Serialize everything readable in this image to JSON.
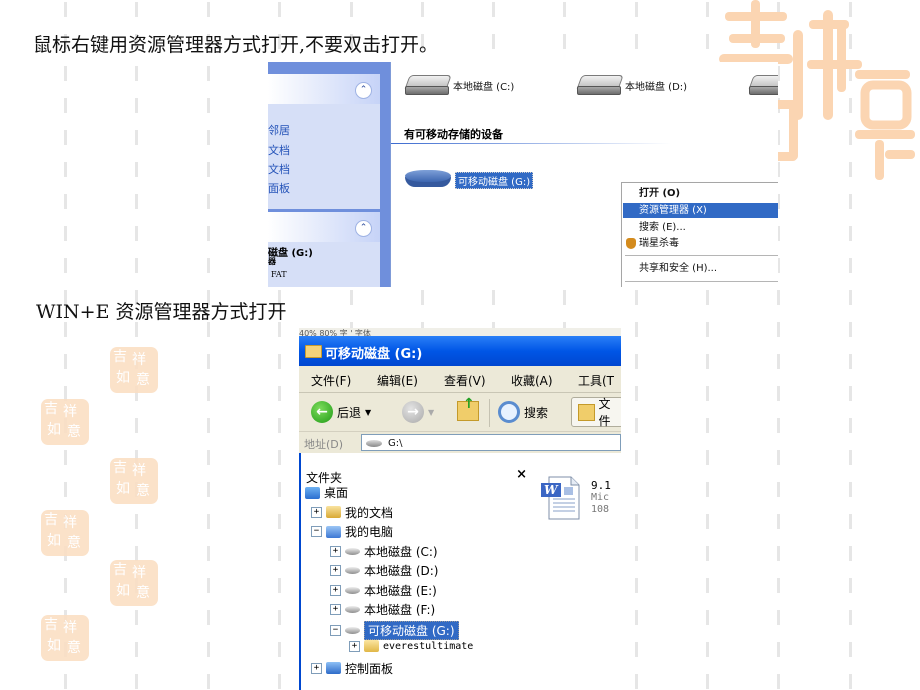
{
  "captions": {
    "first": "鼠标右键用资源管理器方式打开,不要双击打开。",
    "second": "WIN+E 资源管理器方式打开"
  },
  "watermark": {
    "text": "吉祥如意",
    "color": "#fbdfc4"
  },
  "screenshot1": {
    "sidebar": {
      "links": [
        "邻居",
        "文档",
        "文档",
        "面板"
      ],
      "details": {
        "title": "磁盘 (G:)",
        "line2": "器",
        "filesystem": "FAT"
      },
      "collapse_icon": "double-chevron-up-icon"
    },
    "drives": [
      {
        "label": "本地磁盘 (C:)",
        "icon": "hard-drive-icon"
      },
      {
        "label": "本地磁盘 (D:)",
        "icon": "hard-drive-icon"
      },
      {
        "label": "",
        "icon": "hard-drive-icon"
      }
    ],
    "section_title": "有可移动存储的设备",
    "removable_drive": {
      "label": "可移动磁盘 (G:)",
      "icon": "removable-drive-icon"
    },
    "context_menu": {
      "items": [
        {
          "label": "打开 (O)",
          "bold": true
        },
        {
          "label": "资源管理器 (X)",
          "highlighted": true
        },
        {
          "label": "搜索 (E)..."
        },
        {
          "label": "瑞星杀毒",
          "icon": "rising-antivirus-icon"
        },
        {
          "label": "共享和安全 (H)..."
        }
      ]
    },
    "accent": "#316ac5"
  },
  "screenshot2": {
    "top_strip": "40%    80%         字 ' 字体",
    "title": "可移动磁盘 (G:)",
    "menu": [
      "文件(F)",
      "编辑(E)",
      "查看(V)",
      "收藏(A)",
      "工具(T"
    ],
    "toolbar": {
      "back": "后退",
      "search": "搜索",
      "folders": "文件"
    },
    "address": {
      "label": "地址(D)",
      "value": "G:\\"
    },
    "tree": {
      "header": "文件夹",
      "close": "×",
      "items": [
        {
          "label": "桌面",
          "level": 0,
          "toggle": "",
          "icon": "desktop-icon"
        },
        {
          "label": "我的文档",
          "level": 1,
          "toggle": "+",
          "icon": "my-documents-icon"
        },
        {
          "label": "我的电脑",
          "level": 1,
          "toggle": "−",
          "icon": "my-computer-icon"
        },
        {
          "label": "本地磁盘 (C:)",
          "level": 2,
          "toggle": "+",
          "icon": "hard-drive-icon"
        },
        {
          "label": "本地磁盘 (D:)",
          "level": 2,
          "toggle": "+",
          "icon": "hard-drive-icon"
        },
        {
          "label": "本地磁盘 (E:)",
          "level": 2,
          "toggle": "+",
          "icon": "hard-drive-icon"
        },
        {
          "label": "本地磁盘 (F:)",
          "level": 2,
          "toggle": "+",
          "icon": "hard-drive-icon"
        },
        {
          "label": "可移动磁盘 (G:)",
          "level": 2,
          "toggle": "−",
          "icon": "removable-drive-icon",
          "selected": true
        },
        {
          "label": "everestultimate",
          "level": 3,
          "toggle": "+",
          "icon": "folder-icon"
        },
        {
          "label": "控制面板",
          "level": 1,
          "toggle": "+",
          "icon": "control-panel-icon"
        }
      ]
    },
    "file": {
      "name": "9.1",
      "type": "Mic",
      "size": "108",
      "icon": "word-document-icon"
    }
  }
}
